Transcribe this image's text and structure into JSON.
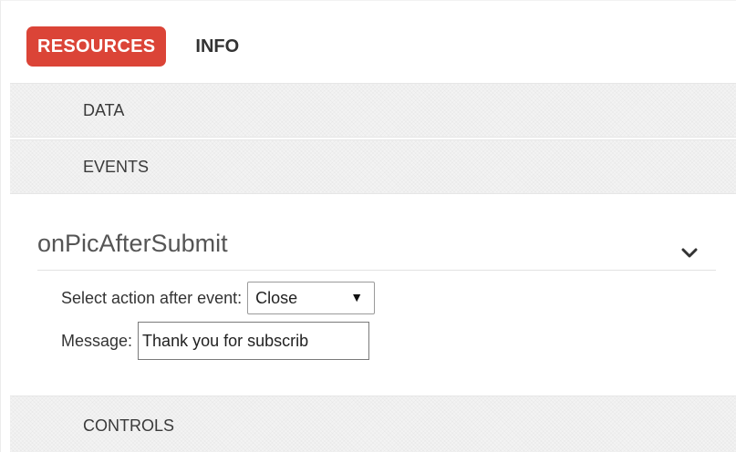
{
  "tabs": {
    "active_label": "RESOURCES",
    "inactive_label": "INFO"
  },
  "sections": {
    "data_label": "DATA",
    "events_label": "EVENTS",
    "controls_label": "CONTROLS"
  },
  "event": {
    "name": "onPicAfterSubmit",
    "expand_icon": "chevron-down-icon",
    "action_label": "Select action after event:",
    "action_value": "Close",
    "message_label": "Message:",
    "message_value": "Thank you for subscrib"
  },
  "colors": {
    "accent": "#db4437",
    "header_bg": "#f3f3f3"
  }
}
